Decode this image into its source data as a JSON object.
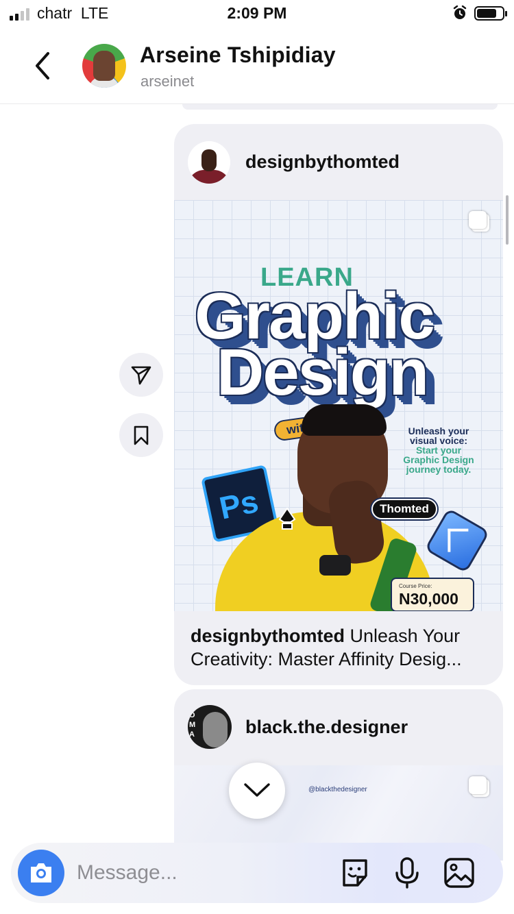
{
  "status_bar": {
    "carrier": "chatr",
    "network": "LTE",
    "time": "2:09 PM"
  },
  "header": {
    "name": "Arseine Tshipidiay",
    "username": "arseinet"
  },
  "post1": {
    "username": "designbythomted",
    "poster": {
      "learn": "LEARN",
      "title_line1": "Graphic",
      "title_line2": "Design",
      "with": "with",
      "tagline_line1": "Unleash your",
      "tagline_line2": "visual voice:",
      "tagline_line3": "Start your",
      "tagline_line4": "Graphic Design",
      "tagline_line5": "journey today.",
      "ps_label": "Ps",
      "name_badge": "Thomted",
      "price_label": "Course Price:",
      "price": "N30,000"
    },
    "caption_user": "designbythomted",
    "caption_text_line1": "Unleash Your",
    "caption_text_line2": "Creativity: Master Affinity Desig..."
  },
  "post2": {
    "username": "black.the.designer",
    "avatar_letters": "O\nM\nA",
    "image_handle": "@blackthedesigner"
  },
  "composer": {
    "placeholder": "Message..."
  }
}
